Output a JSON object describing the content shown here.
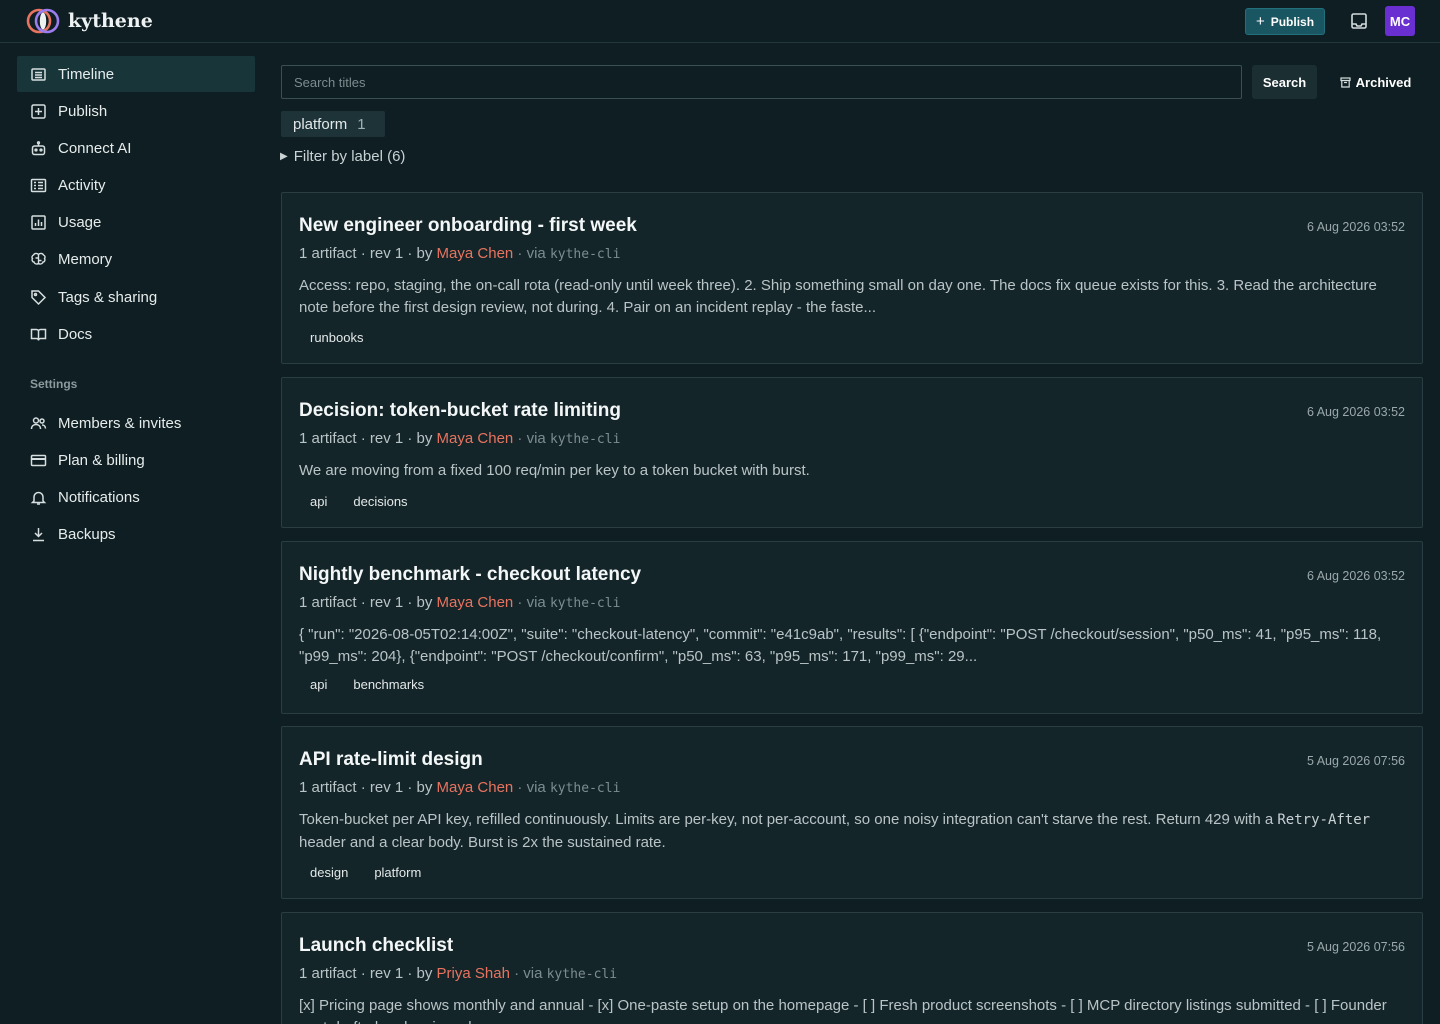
{
  "app": {
    "name": "kythene"
  },
  "topbar": {
    "publish_label": "Publish",
    "avatar_initials": "MC"
  },
  "sidebar": {
    "items": [
      {
        "label": "Timeline",
        "icon": "timeline-icon"
      },
      {
        "label": "Publish",
        "icon": "plus-square-icon"
      },
      {
        "label": "Connect AI",
        "icon": "robot-icon"
      },
      {
        "label": "Activity",
        "icon": "activity-icon"
      },
      {
        "label": "Usage",
        "icon": "chart-icon"
      },
      {
        "label": "Memory",
        "icon": "brain-icon"
      },
      {
        "label": "Tags & sharing",
        "icon": "tag-icon"
      },
      {
        "label": "Docs",
        "icon": "book-icon"
      }
    ],
    "settings_heading": "Settings",
    "settings_items": [
      {
        "label": "Members & invites",
        "icon": "users-icon"
      },
      {
        "label": "Plan & billing",
        "icon": "credit-card-icon"
      },
      {
        "label": "Notifications",
        "icon": "bell-icon"
      },
      {
        "label": "Backups",
        "icon": "download-icon"
      }
    ]
  },
  "search": {
    "placeholder": "Search titles",
    "button_label": "Search",
    "archived_label": "Archived"
  },
  "active_filter": {
    "label": "platform",
    "count": "1"
  },
  "filter_toggle": {
    "label": "Filter by label (6)"
  },
  "cards": [
    {
      "title": "New engineer onboarding - first week",
      "date": "6 Aug 2026 03:52",
      "meta_prefix": "1 artifact · rev 1 · by ",
      "author": "Maya Chen",
      "via_prefix": " · via ",
      "source": "kythe-cli",
      "body": "Access: repo, staging, the on-call rota (read-only until week three). 2. Ship something small on day one. The docs fix queue exists for this. 3. Read the architecture note before the first design review, not during. 4. Pair on an incident replay - the faste...",
      "tags": [
        "runbooks"
      ]
    },
    {
      "title": "Decision: token-bucket rate limiting",
      "date": "6 Aug 2026 03:52",
      "meta_prefix": "1 artifact · rev 1 · by ",
      "author": "Maya Chen",
      "via_prefix": " · via ",
      "source": "kythe-cli",
      "body": "We are moving from a fixed 100 req/min per key to a token bucket with burst.",
      "tags": [
        "api",
        "decisions"
      ]
    },
    {
      "title": "Nightly benchmark - checkout latency",
      "date": "6 Aug 2026 03:52",
      "meta_prefix": "1 artifact · rev 1 · by ",
      "author": "Maya Chen",
      "via_prefix": " · via ",
      "source": "kythe-cli",
      "body": "{ \"run\": \"2026-08-05T02:14:00Z\", \"suite\": \"checkout-latency\", \"commit\": \"e41c9ab\", \"results\": [ {\"endpoint\": \"POST /checkout/session\", \"p50_ms\": 41, \"p95_ms\": 118, \"p99_ms\": 204}, {\"endpoint\": \"POST /checkout/confirm\", \"p50_ms\": 63, \"p95_ms\": 171, \"p99_ms\": 29...",
      "tags": [
        "api",
        "benchmarks"
      ]
    },
    {
      "title": "API rate-limit design",
      "date": "5 Aug 2026 07:56",
      "meta_prefix": "1 artifact · rev 1 · by ",
      "author": "Maya Chen",
      "via_prefix": " · via ",
      "source": "kythe-cli",
      "body_before_code": "Token-bucket per API key, refilled continuously. Limits are per-key, not per-account, so one noisy integration can't starve the rest. Return 429 with a ",
      "body_code": "Retry-After",
      "body_after_code": " header and a clear body. Burst is 2x the sustained rate.",
      "tags": [
        "design",
        "platform"
      ]
    },
    {
      "title": "Launch checklist",
      "date": "5 Aug 2026 07:56",
      "meta_prefix": "1 artifact · rev 1 · by ",
      "author": "Priya Shah",
      "via_prefix": " · via ",
      "source": "kythe-cli",
      "body": "[x] Pricing page shows monthly and annual - [x] One-paste setup on the homepage - [ ] Fresh product screenshots - [ ] MCP directory listings submitted - [ ] Founder post drafted and reviewed",
      "tags": []
    }
  ]
}
